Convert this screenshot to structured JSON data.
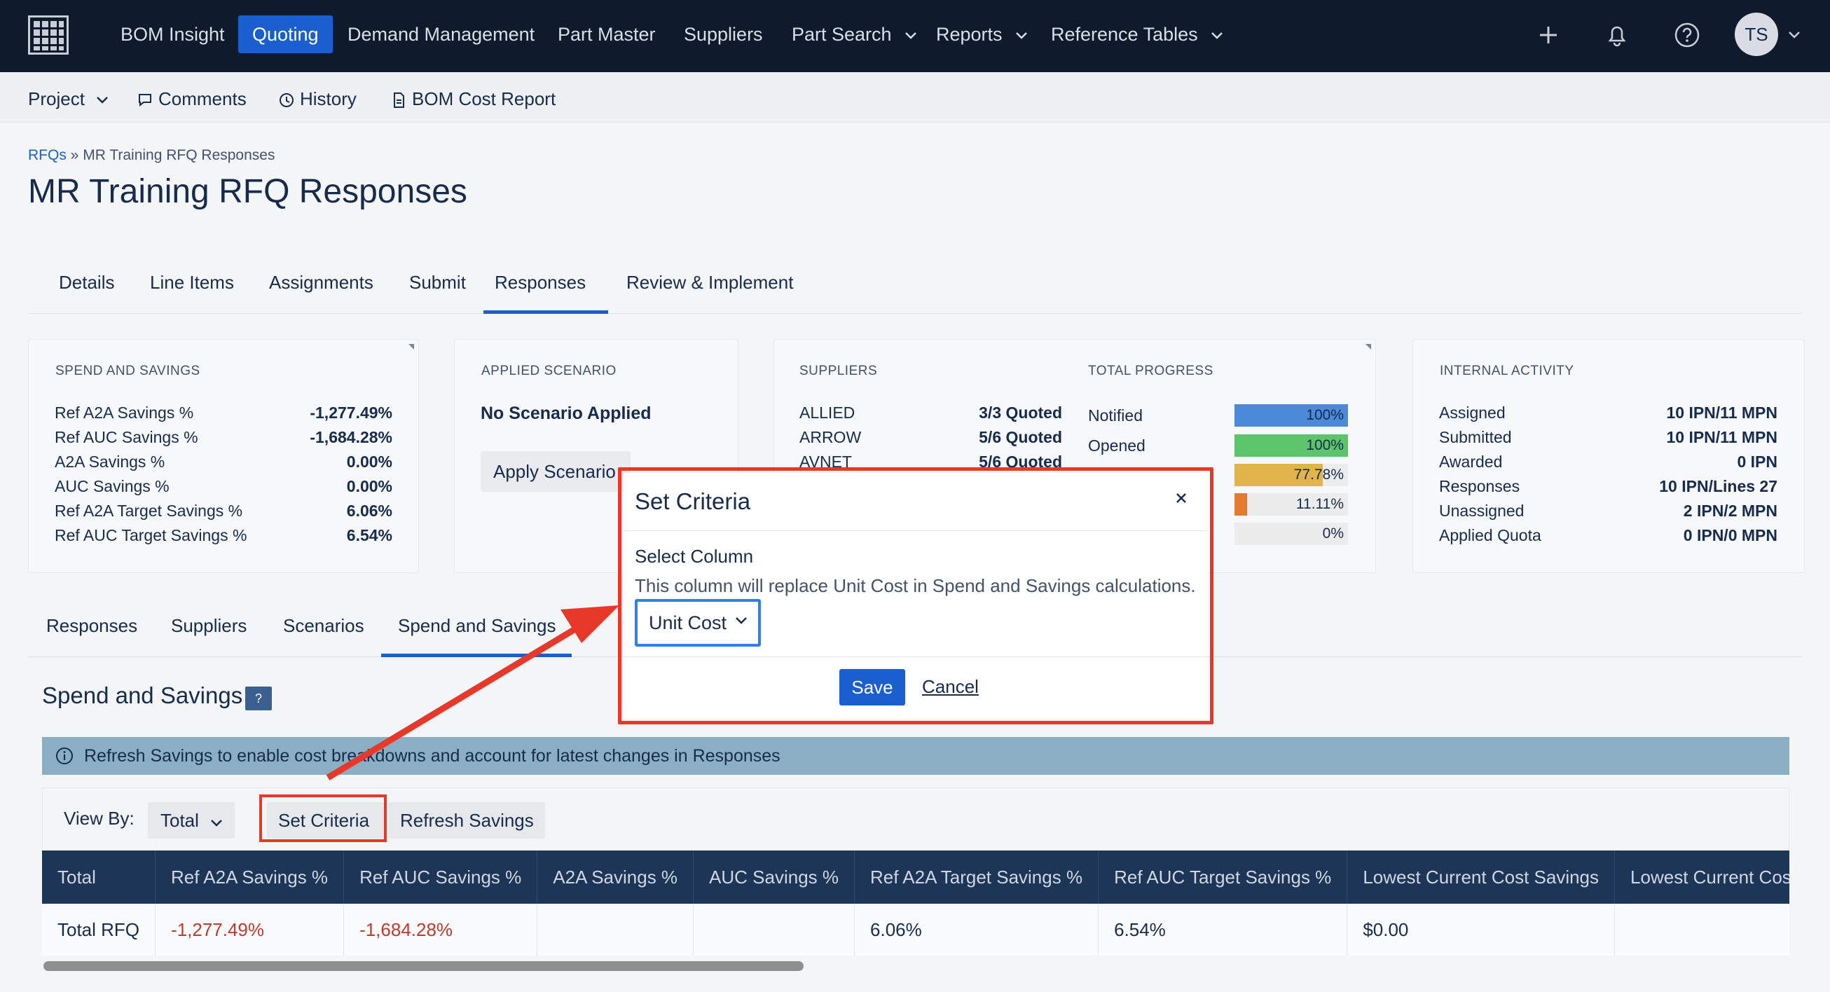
{
  "topnav": {
    "items": [
      {
        "label": "BOM Insight"
      },
      {
        "label": "Quoting"
      },
      {
        "label": "Demand Management"
      },
      {
        "label": "Part Master"
      },
      {
        "label": "Suppliers"
      },
      {
        "label": "Part Search"
      },
      {
        "label": "Reports"
      },
      {
        "label": "Reference Tables"
      }
    ],
    "avatar_initials": "TS"
  },
  "subnav": {
    "project": "Project",
    "comments": "Comments",
    "history": "History",
    "bom_cost_report": "BOM Cost Report"
  },
  "breadcrumb": {
    "root": "RFQs",
    "sep": "»",
    "current": "MR Training RFQ Responses"
  },
  "page_title": "MR Training RFQ Responses",
  "main_tabs": [
    "Details",
    "Line Items",
    "Assignments",
    "Submit",
    "Responses",
    "Review & Implement"
  ],
  "spend_savings_card": {
    "title": "SPEND AND SAVINGS",
    "rows": [
      {
        "label": "Ref A2A Savings %",
        "value": "-1,277.49%"
      },
      {
        "label": "Ref AUC Savings %",
        "value": "-1,684.28%"
      },
      {
        "label": "A2A Savings %",
        "value": "0.00%"
      },
      {
        "label": "AUC Savings %",
        "value": "0.00%"
      },
      {
        "label": "Ref A2A Target Savings %",
        "value": "6.06%"
      },
      {
        "label": "Ref AUC Target Savings %",
        "value": "6.54%"
      }
    ]
  },
  "applied_scenario_card": {
    "title": "APPLIED SCENARIO",
    "status": "No Scenario Applied",
    "button": "Apply Scenario"
  },
  "suppliers_card": {
    "title": "SUPPLIERS",
    "rows": [
      {
        "label": "ALLIED",
        "value": "3/3 Quoted"
      },
      {
        "label": "ARROW",
        "value": "5/6 Quoted"
      },
      {
        "label": "AVNET",
        "value": "5/6 Quoted"
      }
    ]
  },
  "progress_card": {
    "title": "TOTAL PROGRESS",
    "rows": [
      {
        "label": "Notified",
        "value": "100%",
        "percent": 100,
        "color": "#4a8ad8"
      },
      {
        "label": "Opened",
        "value": "100%",
        "percent": 100,
        "color": "#5cc46a"
      },
      {
        "label": "",
        "value": "77.78%",
        "percent": 77.78,
        "color": "#e0b44a"
      },
      {
        "label": "",
        "value": "11.11%",
        "percent": 11.11,
        "color": "#e37a2e"
      },
      {
        "label": "",
        "value": "0%",
        "percent": 0,
        "color": "#e8aac2"
      }
    ]
  },
  "internal_activity_card": {
    "title": "INTERNAL ACTIVITY",
    "rows": [
      {
        "label": "Assigned",
        "value": "10 IPN/11 MPN"
      },
      {
        "label": "Submitted",
        "value": "10 IPN/11 MPN"
      },
      {
        "label": "Awarded",
        "value": "0 IPN"
      },
      {
        "label": "Responses",
        "value": "10 IPN/Lines 27"
      },
      {
        "label": "Unassigned",
        "value": "2 IPN/2 MPN"
      },
      {
        "label": "Applied Quota",
        "value": "0 IPN/0 MPN"
      }
    ]
  },
  "sub_tabs": [
    "Responses",
    "Suppliers",
    "Scenarios",
    "Spend and Savings"
  ],
  "section": {
    "title": "Spend and Savings",
    "help": "?"
  },
  "banner": "Refresh Savings to enable cost breakdowns and account for latest changes in Responses",
  "controls": {
    "view_by_label": "View By:",
    "view_by_value": "Total",
    "set_criteria": "Set Criteria",
    "refresh_savings": "Refresh Savings"
  },
  "table": {
    "headers": [
      "Total",
      "Ref A2A Savings %",
      "Ref AUC Savings %",
      "A2A Savings %",
      "AUC Savings %",
      "Ref A2A Target Savings %",
      "Ref AUC Target Savings %",
      "Lowest Current Cost Savings",
      "Lowest Current Cost Savings %"
    ],
    "rows": [
      [
        "Total RFQ",
        "-1,277.49%",
        "-1,684.28%",
        "",
        "",
        "6.06%",
        "6.54%",
        "$0.00",
        ""
      ]
    ]
  },
  "modal": {
    "title": "Set Criteria",
    "label": "Select Column",
    "description": "This column will replace Unit Cost in Spend and Savings calculations.",
    "selected": "Unit Cost",
    "save": "Save",
    "cancel": "Cancel"
  },
  "colors": {
    "brand_blue": "#1a5fcf",
    "nav_bg": "#0f1b2d",
    "highlight_red": "#e8382a",
    "negative_red": "#c0392b"
  }
}
